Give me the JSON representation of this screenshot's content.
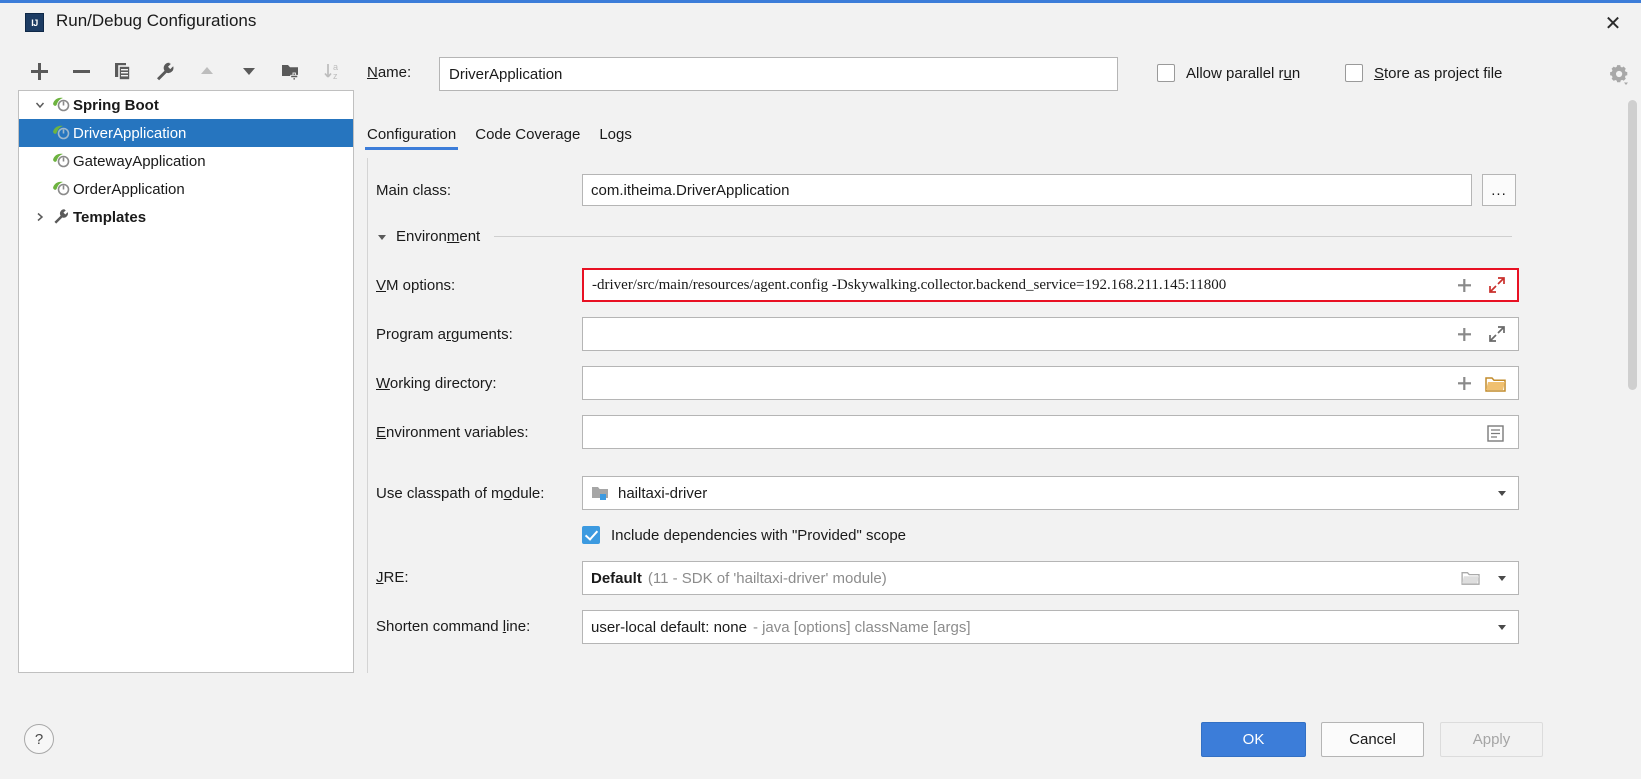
{
  "window": {
    "title": "Run/Debug Configurations",
    "app_icon": "IJ",
    "close_icon": "✕"
  },
  "toolbar": {
    "buttons": [
      {
        "name": "add-configuration-button",
        "icon": "plus-icon",
        "enabled": true
      },
      {
        "name": "remove-configuration-button",
        "icon": "minus-icon",
        "enabled": true
      },
      {
        "name": "copy-configuration-button",
        "icon": "copy-icon",
        "enabled": true
      },
      {
        "name": "edit-templates-button",
        "icon": "wrench-icon",
        "enabled": true
      },
      {
        "name": "move-up-button",
        "icon": "arrow-up-icon",
        "enabled": false
      },
      {
        "name": "move-down-button",
        "icon": "arrow-down-icon",
        "enabled": true
      },
      {
        "name": "new-folder-button",
        "icon": "folder-add-icon",
        "enabled": true
      },
      {
        "name": "sort-alphabetically-button",
        "icon": "sort-az-icon",
        "enabled": false
      }
    ]
  },
  "tree": {
    "items": [
      {
        "label": "Spring Boot",
        "level": 0,
        "expanded": true,
        "bold": true,
        "icon": "spring-boot-icon",
        "selected": false
      },
      {
        "label": "DriverApplication",
        "level": 1,
        "expanded": null,
        "bold": false,
        "icon": "spring-boot-icon",
        "selected": true
      },
      {
        "label": "GatewayApplication",
        "level": 1,
        "expanded": null,
        "bold": false,
        "icon": "spring-boot-icon",
        "selected": false
      },
      {
        "label": "OrderApplication",
        "level": 1,
        "expanded": null,
        "bold": false,
        "icon": "spring-boot-icon",
        "selected": false
      },
      {
        "label": "Templates",
        "level": 0,
        "expanded": false,
        "bold": true,
        "icon": "wrench-icon",
        "selected": false
      }
    ]
  },
  "header": {
    "name_label_pre": "N",
    "name_label_post": "ame:",
    "name_value": "DriverApplication",
    "allow_parallel_run": {
      "label_pre": "Allow parallel r",
      "label_mn": "u",
      "label_post": "n",
      "checked": false
    },
    "store_as_project_file": {
      "label_mn": "S",
      "label_post": "tore as project file",
      "checked": false
    },
    "gear_icon": "gear-dropdown-icon"
  },
  "tabs": [
    {
      "label": "Configuration",
      "active": true
    },
    {
      "label": "Code Coverage",
      "active": false
    },
    {
      "label": "Logs",
      "active": false
    }
  ],
  "configuration": {
    "main_class": {
      "label": "Main class:",
      "value": "com.itheima.DriverApplication",
      "browse_label": "..."
    },
    "environment_section": {
      "label_pre": "Environ",
      "label_mn": "m",
      "label_post": "ent",
      "expanded": true
    },
    "vm_options": {
      "label_mn": "V",
      "label_post": "M options:",
      "value": "-driver/src/main/resources/agent.config  -Dskywalking.collector.backend_service=192.168.211.145:11800",
      "highlighted": true,
      "highlight_color": "#e81123",
      "macro_icon": "insert-macro-icon",
      "expand_icon": "expand-editor-icon"
    },
    "program_arguments": {
      "label_pre": "Program a",
      "label_mn": "r",
      "label_post": "guments:",
      "value": "",
      "macro_icon": "insert-macro-icon",
      "expand_icon": "expand-editor-icon"
    },
    "working_directory": {
      "label_mn": "W",
      "label_post": "orking directory:",
      "value": "",
      "macro_icon": "insert-macro-icon",
      "browse_icon": "folder-icon"
    },
    "environment_variables": {
      "label_mn": "E",
      "label_post": "nvironment variables:",
      "value": "",
      "browse_icon": "variables-list-icon"
    },
    "classpath_module": {
      "label_pre": "Use classpath of m",
      "label_mn": "o",
      "label_post": "dule:",
      "value": "hailtaxi-driver",
      "icon": "module-icon",
      "arrow_icon": "chevron-down-icon"
    },
    "include_dependencies": {
      "label": "Include dependencies with \"Provided\" scope",
      "checked": true
    },
    "jre": {
      "label_mn": "J",
      "label_post": "RE:",
      "value_bold": "Default",
      "value_gray": "(11 - SDK of 'hailtaxi-driver' module)",
      "browse_icon": "folder-icon",
      "arrow_icon": "chevron-down-icon"
    },
    "shorten_command_line": {
      "label_pre": "Shorten command ",
      "label_mn": "l",
      "label_post": "ine:",
      "value_bold": "user-local default: none",
      "value_gray": "- java [options] className [args]",
      "arrow_icon": "chevron-down-icon"
    }
  },
  "footer": {
    "help_label": "?",
    "ok_label": "OK",
    "cancel_label": "Cancel",
    "apply_label": "Apply",
    "apply_enabled": false
  },
  "colors": {
    "accent": "#3c7dd9",
    "selection": "#2675bf",
    "highlight": "#e81123",
    "checkbox_checked": "#3c9ae0"
  }
}
